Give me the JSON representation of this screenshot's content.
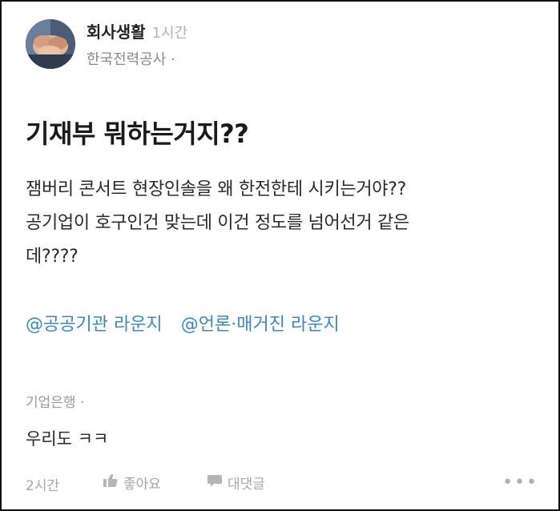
{
  "post": {
    "channel": "회사생활",
    "time": "1시간",
    "author_company": "한국전력공사 ·",
    "title": "기재부 뭐하는거지??",
    "body_lines": [
      "잼버리 콘서트 현장인솔을 왜 한전한테 시키는거야??",
      "공기업이 호구인건 맞는데 이건 정도를 넘어선거 같은",
      "데????"
    ],
    "tags": [
      "@공공기관 라운지",
      "@언론·매거진 라운지"
    ]
  },
  "comment": {
    "company": "기업은행 ·",
    "text": "우리도 ㅋㅋ",
    "time": "2시간",
    "like_label": "좋아요",
    "reply_label": "대댓글",
    "more_label": "•••"
  },
  "icons": {
    "avatar": "avatar-hands-icon",
    "like": "thumbs-up-icon",
    "reply": "speech-bubble-icon",
    "more": "more-dots-icon"
  },
  "colors": {
    "tag": "#3b86c4",
    "muted": "#9a9a9a"
  }
}
